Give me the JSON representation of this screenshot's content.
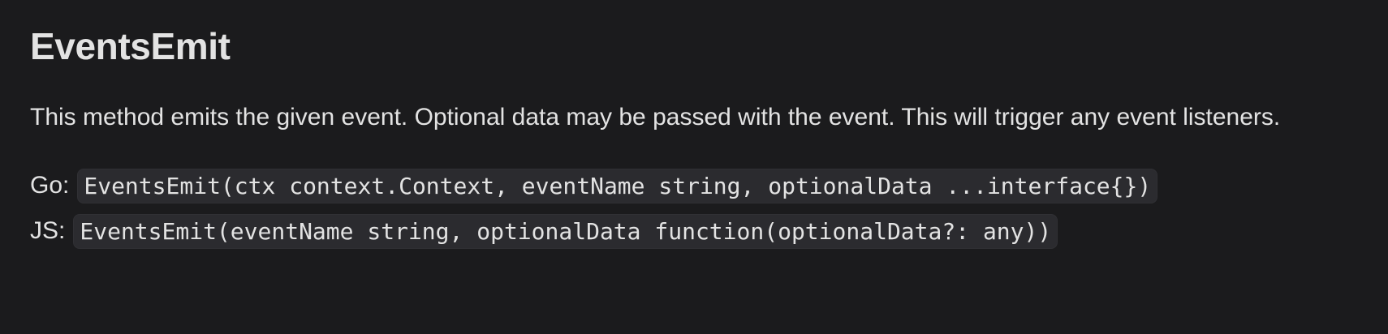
{
  "section": {
    "title": "EventsEmit",
    "description": "This method emits the given event. Optional data may be passed with the event. This will trigger any event listeners."
  },
  "signatures": [
    {
      "lang": "Go:",
      "code": "EventsEmit(ctx context.Context, eventName string, optionalData ...interface{})"
    },
    {
      "lang": "JS:",
      "code": "EventsEmit(eventName string, optionalData function(optionalData?: any))"
    }
  ]
}
